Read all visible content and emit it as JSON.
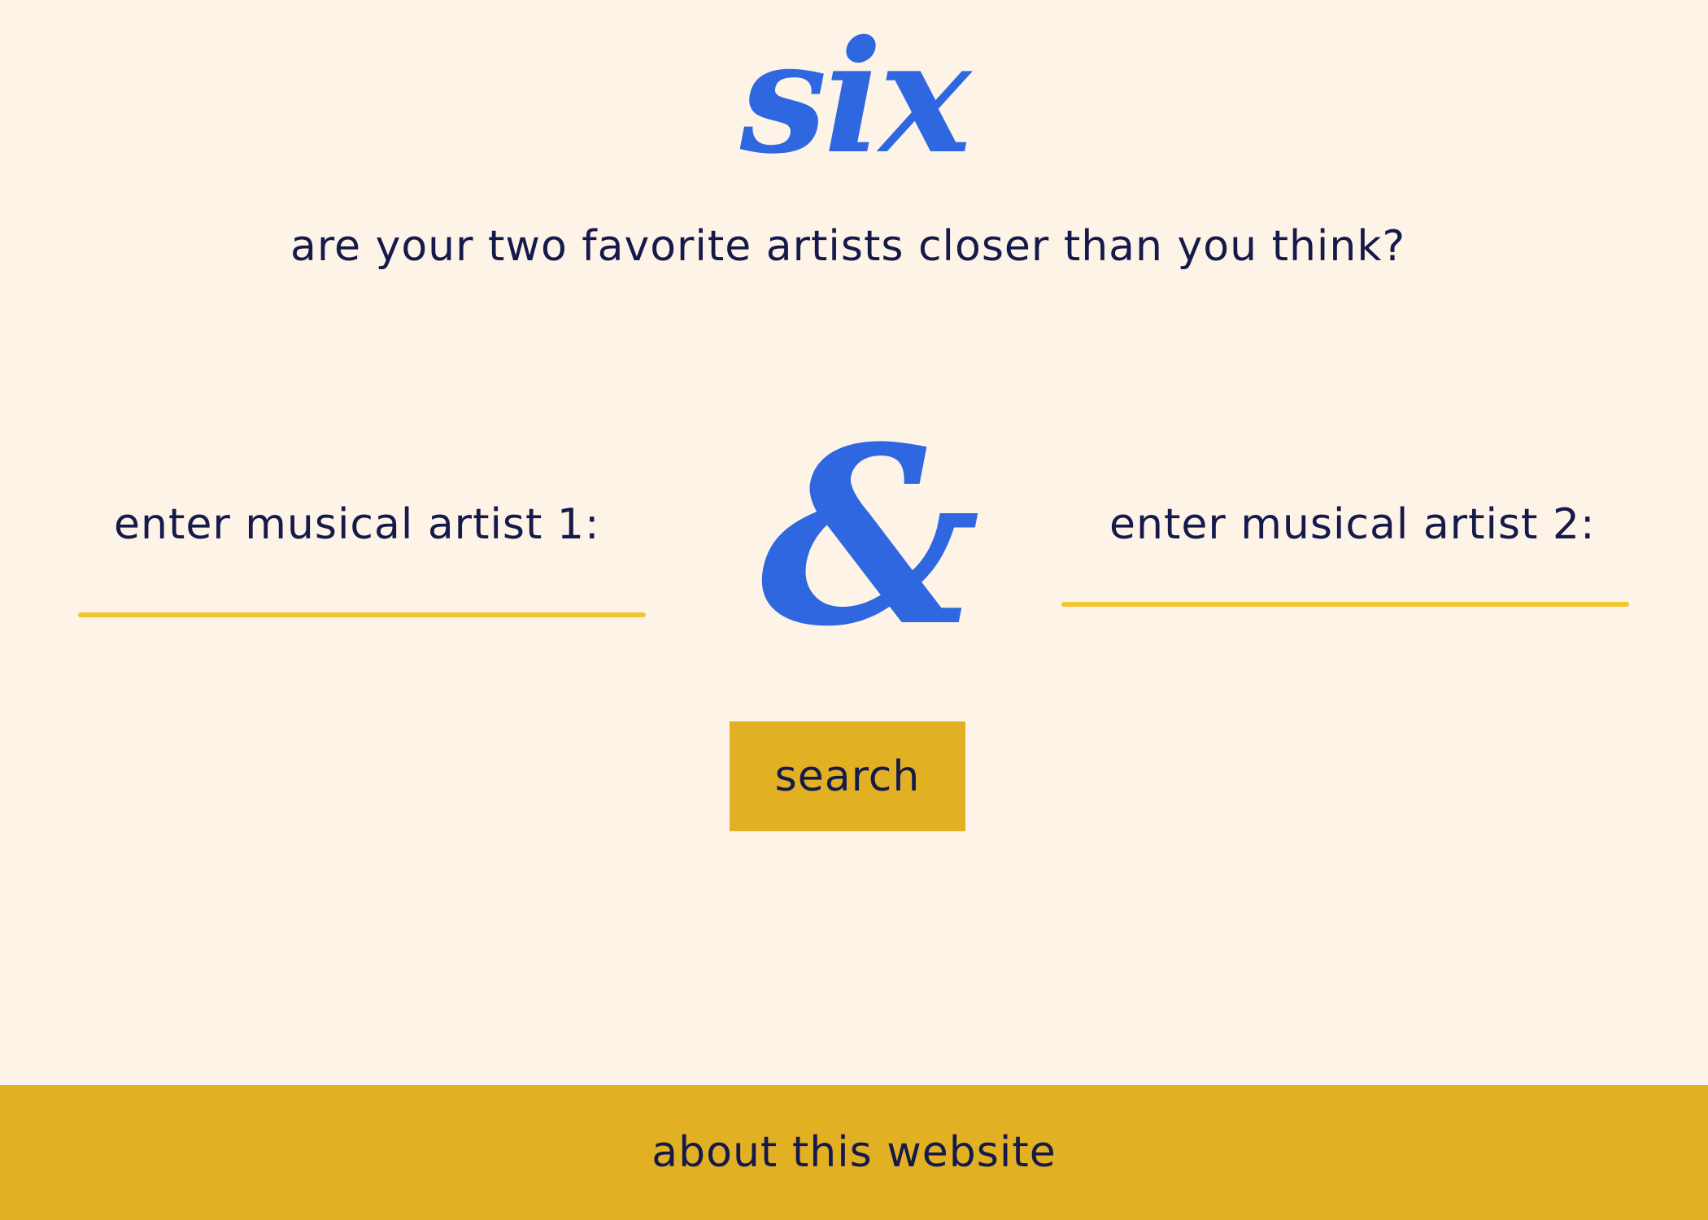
{
  "header": {
    "logo_text": "six",
    "tagline": "are your two favorite artists closer than you think?"
  },
  "form": {
    "artist1": {
      "label": "enter musical artist 1:",
      "value": "",
      "placeholder": ""
    },
    "artist2": {
      "label": "enter musical artist 2:",
      "value": "",
      "placeholder": ""
    },
    "ampersand": "&",
    "search_label": "search"
  },
  "footer": {
    "about_label": "about this website"
  },
  "colors": {
    "background": "#fdf3e7",
    "accent_blue": "#2f67e0",
    "accent_yellow": "#e2b023",
    "underline_yellow": "#f4c531",
    "text_navy": "#151a4a"
  }
}
